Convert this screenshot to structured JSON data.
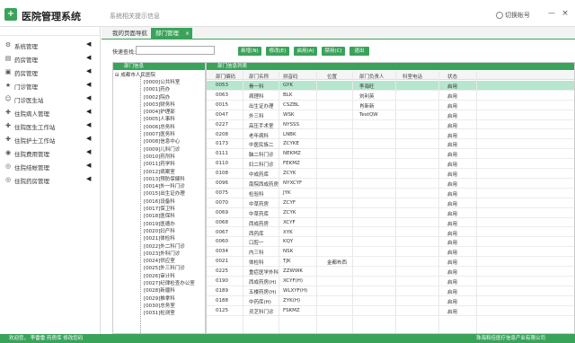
{
  "app": {
    "title": "医院管理系统",
    "logo": "",
    "system_message": "系统相关提示信息",
    "switch_account": "切换帐号",
    "minimize": "—",
    "close": "×"
  },
  "sidebar": {
    "items": [
      {
        "label": "系统管理",
        "icon": "gear-icon",
        "glyph": "⚙"
      },
      {
        "label": "药房管理",
        "icon": "building-icon",
        "glyph": "▤"
      },
      {
        "label": "药房管理",
        "icon": "cart-icon",
        "glyph": "▣"
      },
      {
        "label": "门诊管理",
        "icon": "star-icon",
        "glyph": "★"
      },
      {
        "label": "门诊医生站",
        "icon": "person-icon",
        "glyph": "☺"
      },
      {
        "label": "住院病人管理",
        "icon": "bed-icon",
        "glyph": "✚"
      },
      {
        "label": "住院医生工作站",
        "icon": "doctor-icon",
        "glyph": "✚"
      },
      {
        "label": "住院护士工作站",
        "icon": "nurse-icon",
        "glyph": "✚"
      },
      {
        "label": "住院费用管理",
        "icon": "money-icon",
        "glyph": "◉"
      },
      {
        "label": "住院结帐管理",
        "icon": "checkout-icon",
        "glyph": "◎"
      },
      {
        "label": "住院药房管理",
        "icon": "pharmacy-icon",
        "glyph": "◎"
      }
    ]
  },
  "tabs": {
    "home": "我的页面导航",
    "dept": "部门管理",
    "dept_close": "×"
  },
  "toolbar": {
    "search_label": "快速查找:",
    "search_value": "",
    "buttons": [
      "新增(N)",
      "修改(E)",
      "启用(A)",
      "禁用(C)",
      "退出"
    ]
  },
  "tree": {
    "header": "部门信息",
    "root": "成都市人民医院",
    "nodes": [
      "[0000]公共科室",
      "[0001]药办",
      "[0002]院办",
      "[0003]财务科",
      "[0004]护理部",
      "[0005]人事科",
      "[0006]总务科",
      "[0007]医务科",
      "[0008]信息中心",
      "[0009]儿科门诊",
      "[0010]药剂科",
      "[0011]药学科",
      "[0012]病案室",
      "[0013]预防保健科",
      "[0014]外一科门诊",
      "[0015]出生证办理",
      "[0016]设备科",
      "[0017]保卫科",
      "[0018]医保科",
      "[0019]医德办",
      "[0020]妇产科",
      "[0021]体检科",
      "[0022]外二科门诊",
      "[0023]外科门诊",
      "[0024]供应室",
      "[0025]外三科门诊",
      "[0026]审计科",
      "[0027]纪律检查办公室",
      "[0028]新疆科",
      "[0029]推拿科",
      "[0030]总务室",
      "[0031]检测室"
    ]
  },
  "grid": {
    "header": "部门信息列表",
    "columns": [
      "部门编码",
      "部门名称",
      "拼音码",
      "位置",
      "部门负责人",
      "科室电话",
      "状态"
    ],
    "rows": [
      [
        "0053",
        "骨一科",
        "GYK",
        "",
        "李海旺",
        "",
        "启用"
      ],
      [
        "0063",
        "病理科",
        "BLK",
        "",
        "刘利英",
        "",
        "启用"
      ],
      [
        "0015",
        "出生证办理",
        "CSZBL",
        "",
        "肖新新",
        "",
        "启用"
      ],
      [
        "0047",
        "外三科",
        "WSK",
        "",
        "TestQW",
        "",
        "启用"
      ],
      [
        "0227",
        "高压手术室",
        "NYSSS",
        "",
        "",
        "",
        "启用"
      ],
      [
        "0208",
        "老年病科",
        "LNBK",
        "",
        "",
        "",
        "启用"
      ],
      [
        "0173",
        "中医民族二",
        "ZCYKE",
        "",
        "",
        "",
        "启用"
      ],
      [
        "0111",
        "脑二科门诊",
        "NEKMZ",
        "",
        "",
        "",
        "启用"
      ],
      [
        "0110",
        "妇二科门诊",
        "FEKMZ",
        "",
        "",
        "",
        "启用"
      ],
      [
        "0108",
        "中成药库",
        "ZCYK",
        "",
        "",
        "",
        "启用"
      ],
      [
        "0096",
        "南院西成药房",
        "NYXCYF",
        "",
        "",
        "",
        "启用"
      ],
      [
        "0075",
        "检验科",
        "JYK",
        "",
        "",
        "",
        "启用"
      ],
      [
        "0070",
        "中草药房",
        "ZCYF",
        "",
        "",
        "",
        "启用"
      ],
      [
        "0069",
        "中草药库",
        "ZCYK",
        "",
        "",
        "",
        "启用"
      ],
      [
        "0068",
        "西成药房",
        "XCYF",
        "",
        "",
        "",
        "启用"
      ],
      [
        "0067",
        "西药库",
        "XYK",
        "",
        "",
        "",
        "启用"
      ],
      [
        "0060",
        "口腔一",
        "KQY",
        "",
        "",
        "",
        "启用"
      ],
      [
        "0034",
        "内三科",
        "NSK",
        "",
        "",
        "",
        "启用"
      ],
      [
        "0021",
        "体检科",
        "TJK",
        "金都布西",
        "",
        "",
        "启用"
      ],
      [
        "0225",
        "重症医学外科",
        "ZZWWK",
        "",
        "",
        "",
        "启用"
      ],
      [
        "0190",
        "西成药房(H)",
        "XCYF(H)",
        "",
        "",
        "",
        "启用"
      ],
      [
        "0189",
        "五楼药房(H)",
        "WLXYF(H)",
        "",
        "",
        "",
        "启用"
      ],
      [
        "0188",
        "中药库(H)",
        "ZYK(H)",
        "",
        "",
        "",
        "启用"
      ],
      [
        "0125",
        "灵芝科门诊",
        "FSKMZ",
        "",
        "",
        "",
        "启用"
      ]
    ],
    "selected_row": 0
  },
  "status": {
    "left": "欢迎您， 李雷雷  药房库  修改您码",
    "right": "珠海和佳医疗信息产业有限公司"
  },
  "colors": {
    "accent": "#3aa35a",
    "selected": "#b6e6cf"
  }
}
